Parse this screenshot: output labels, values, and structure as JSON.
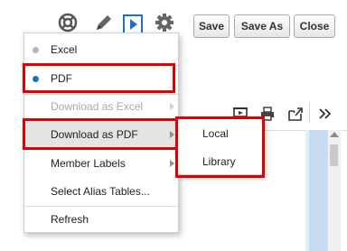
{
  "toolbar": {
    "icons": [
      "lifebuoy-icon",
      "pencil-icon",
      "play-icon",
      "gear-icon"
    ],
    "save_label": "Save",
    "save_as_label": "Save As",
    "close_label": "Close"
  },
  "secondary_toolbar": {
    "icons": [
      "presentation-icon",
      "print-icon",
      "export-icon",
      "double-chevron-right-icon"
    ]
  },
  "menu": {
    "items": [
      {
        "label": "Excel",
        "selected": false,
        "enabled": true
      },
      {
        "label": "PDF",
        "selected": true,
        "enabled": true
      },
      {
        "label": "Download as Excel",
        "enabled": false,
        "submenu": true
      },
      {
        "label": "Download as PDF",
        "enabled": true,
        "submenu": true,
        "active": true
      },
      {
        "label": "Member Labels",
        "enabled": true,
        "submenu": true
      },
      {
        "label": "Select Alias Tables...",
        "enabled": true
      },
      {
        "label": "Refresh",
        "enabled": true
      }
    ]
  },
  "submenu": {
    "items": [
      {
        "label": "Local"
      },
      {
        "label": "Library"
      }
    ]
  },
  "colors": {
    "highlight": "#e00000",
    "bullet_selected": "#1f6fc5",
    "bullet_unselected": "#b5b5b5",
    "active_row": "#e4e4e4",
    "icon_blue": "#1f6fc5"
  }
}
